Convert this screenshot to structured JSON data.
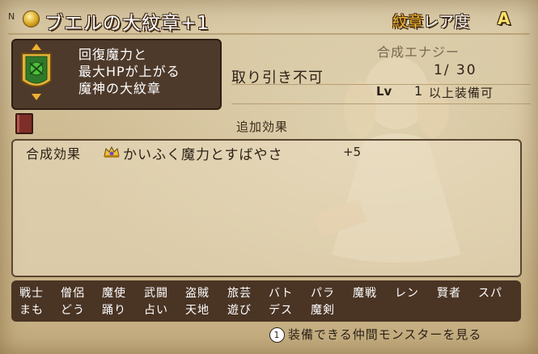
{
  "header": {
    "badge": "N",
    "title": "ブエルの大紋章+1",
    "rarity_label_1": "紋章",
    "rarity_label_2": "レア度",
    "rarity_value": "A"
  },
  "item": {
    "icon": "emblem-icon",
    "description_lines": [
      "回復魔力と",
      "最大HPが上がる",
      "魔神の大紋章"
    ]
  },
  "trade": "取り引き不可",
  "energy": {
    "label": "合成エナジー",
    "value": "1/ 30"
  },
  "level": {
    "label": "Lv",
    "value": "1",
    "suffix": "以上装備可"
  },
  "extra_effects": {
    "title": "追加効果",
    "rows": [
      {
        "label": "合成効果",
        "icon": "crown-icon",
        "text": "かいふく魔力とすばやさ",
        "value": "+5"
      }
    ]
  },
  "jobs": {
    "row1": [
      "戦士",
      "僧侶",
      "魔使",
      "武闘",
      "盗賊",
      "旅芸",
      "バト",
      "パラ",
      "魔戦",
      "レン",
      "賢者",
      "スパ"
    ],
    "row2": [
      "まも",
      "どう",
      "踊り",
      "占い",
      "天地",
      "遊び",
      "デス",
      "魔剣"
    ]
  },
  "footer": {
    "button": "1",
    "text": "装備できる仲間モンスターを見る"
  }
}
